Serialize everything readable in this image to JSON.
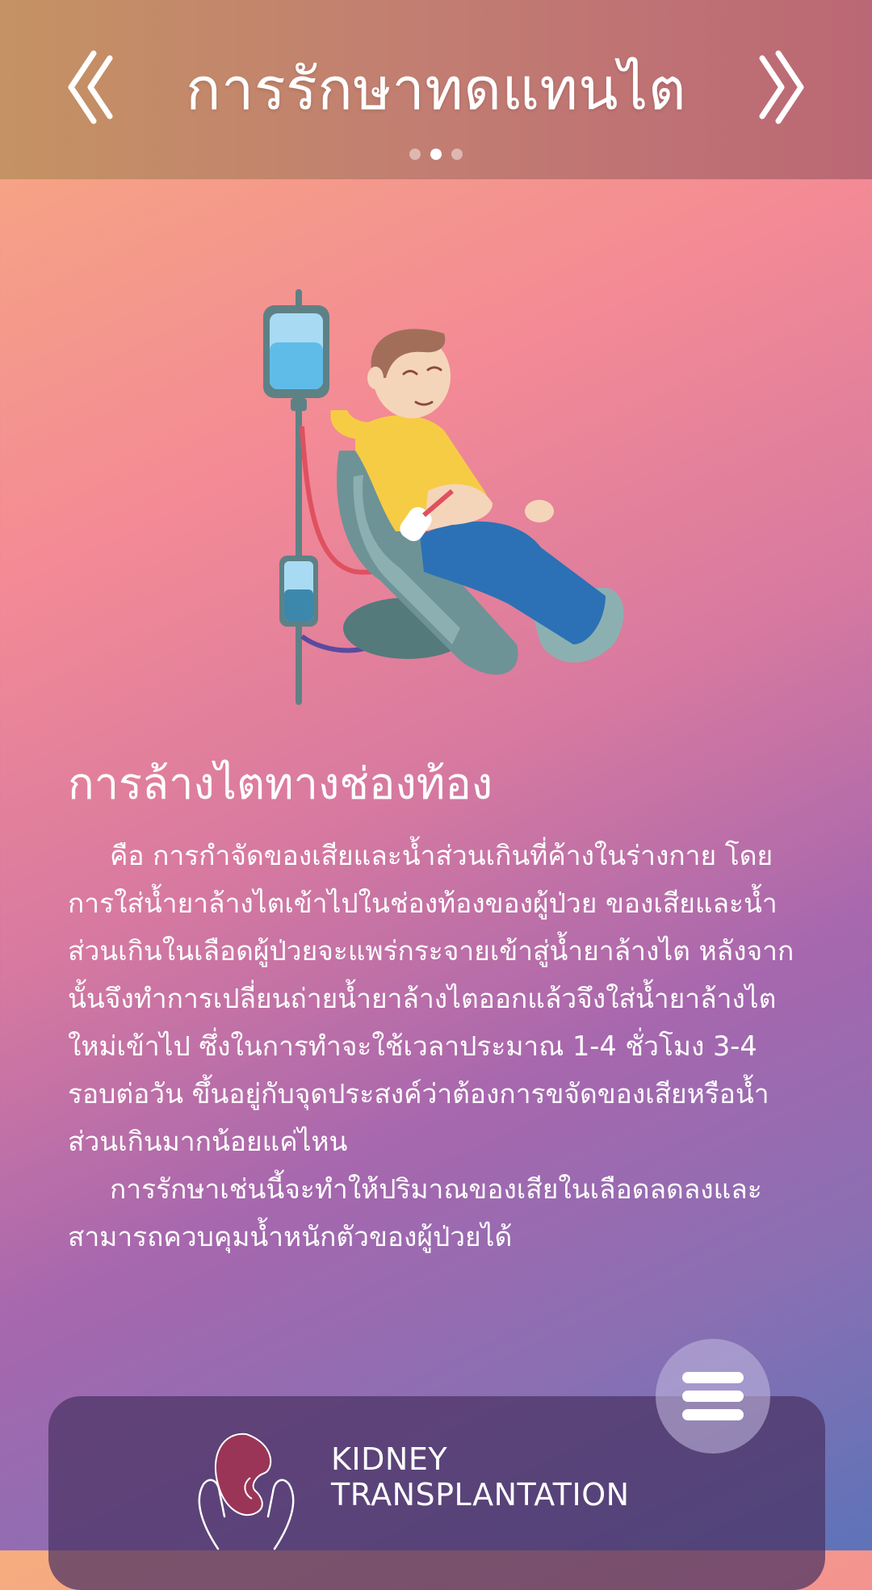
{
  "header": {
    "title": "การรักษาทดแทนไต",
    "pagination": {
      "total": 3,
      "active_index": 1
    }
  },
  "icons": {
    "prev": "double-chevron-left-icon",
    "next": "double-chevron-right-icon",
    "menu": "hamburger-menu-icon",
    "illustration": "peritoneal-dialysis-illustration",
    "logo": "kidney-hands-logo-icon"
  },
  "content": {
    "section_title": "การล้างไตทางช่องท้อง",
    "paragraphs": [
      "คือ การกำจัดของเสียและน้ำส่วนเกินที่ค้างในร่างกาย โดยการใส่น้ำยาล้างไตเข้าไปในช่องท้องของผู้ป่วย ของเสียและน้ำส่วนเกินในเลือดผู้ป่วยจะแพร่กระจายเข้าสู่น้ำยาล้างไต หลังจากนั้นจึงทำการเปลี่ยนถ่ายน้ำยาล้างไตออกแล้วจึงใส่น้ำยาล้างไตใหม่เข้าไป ซึ่งในการทำจะใช้เวลาประมาณ 1-4 ชั่วโมง 3-4 รอบต่อวัน ขึ้นอยู่กับจุดประสงค์ว่าต้องการขจัดของเสียหรือน้ำส่วนเกินมากน้อยแค่ไหน",
      "การรักษาเช่นนี้จะทำให้ปริมาณของเสียในเลือดลดลงและสามารถควบคุมน้ำหนักตัวของผู้ป่วยได้"
    ]
  },
  "brand": {
    "line1": "KIDNEY",
    "line2": "TRANSPLANTATION"
  },
  "colors": {
    "header_start": "#c49263",
    "header_end": "#bb6775",
    "bg_top": "#f7ad7e",
    "bg_bottom": "#5d73b8",
    "kidney": "#9b3557"
  }
}
